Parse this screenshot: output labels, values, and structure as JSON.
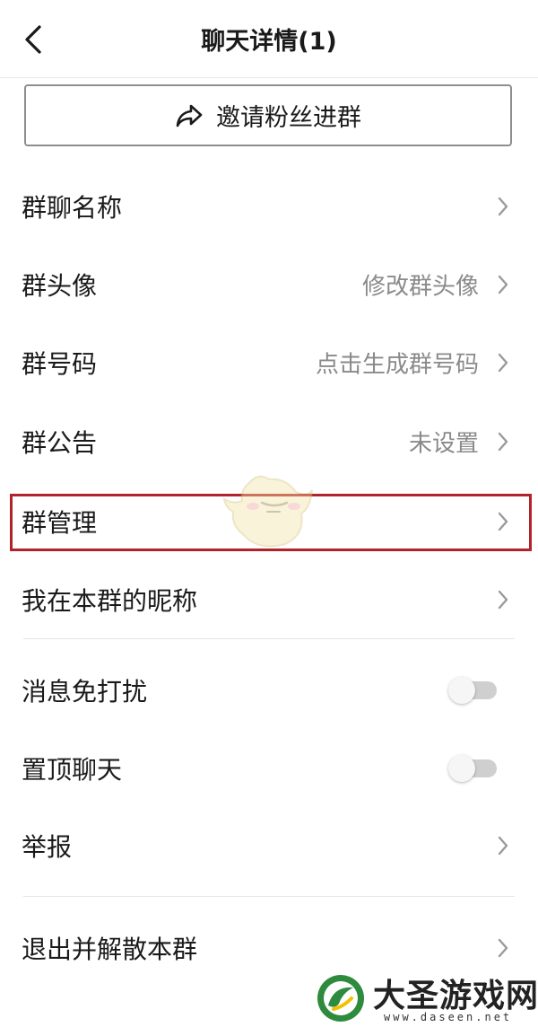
{
  "header": {
    "title": "聊天详情(1)"
  },
  "invite_button": {
    "label": "邀请粉丝进群",
    "icon": "share-icon"
  },
  "settings": [
    {
      "label": "群聊名称",
      "value": "",
      "control": "chevron"
    },
    {
      "label": "群头像",
      "value": "修改群头像",
      "control": "chevron"
    },
    {
      "label": "群号码",
      "value": "点击生成群号码",
      "control": "chevron"
    },
    {
      "label": "群公告",
      "value": "未设置",
      "control": "chevron"
    },
    {
      "label": "群管理",
      "value": "",
      "control": "chevron",
      "highlighted": true
    },
    {
      "label": "我在本群的昵称",
      "value": "",
      "control": "chevron"
    },
    {
      "label": "消息免打扰",
      "control": "toggle",
      "on": false
    },
    {
      "label": "置顶聊天",
      "control": "toggle",
      "on": false
    },
    {
      "label": "举报",
      "value": "",
      "control": "chevron"
    },
    {
      "label": "退出并解散本群",
      "value": "",
      "control": "chevron"
    }
  ],
  "watermark": {
    "brand": "大圣游戏网",
    "url": "www.daseen.net"
  },
  "colors": {
    "highlight_border": "#b0232a",
    "secondary_text": "#8a8a8a",
    "toggle_track": "#cfcfcf",
    "logo_green": "#2e8b3e"
  }
}
